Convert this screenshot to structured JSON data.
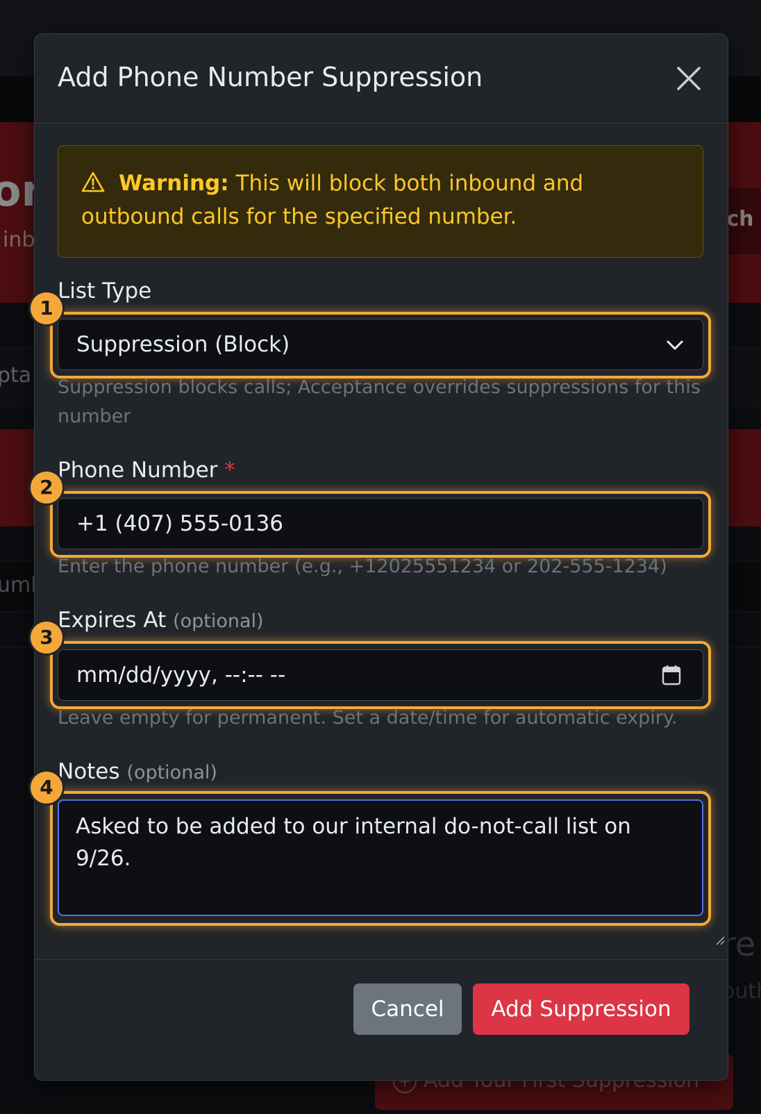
{
  "background": {
    "hero_fragment": "on",
    "hero_sub_fragment": "inb",
    "hero_button_fragment": "ech",
    "row_fragment": "pta",
    "row2_fragment": "umb",
    "empty_title_fragment": "re",
    "empty_sub_fragment": "outh",
    "first_button_label": "Add Your First Suppression"
  },
  "modal": {
    "title": "Add Phone Number Suppression",
    "alert": {
      "strong": "Warning:",
      "text": " This will block both inbound and outbound calls for the specified number."
    },
    "fields": {
      "list_type": {
        "badge": "1",
        "label": "List Type",
        "value": "Suppression (Block)",
        "help": "Suppression blocks calls; Acceptance overrides suppressions for this number"
      },
      "phone": {
        "badge": "2",
        "label": "Phone Number",
        "required_mark": "*",
        "value": "+1 (407) 555-0136",
        "help": "Enter the phone number (e.g., +12025551234 or 202-555-1234)"
      },
      "expires": {
        "badge": "3",
        "label": "Expires At",
        "optional": "(optional)",
        "placeholder": "mm/dd/yyyy, --:-- --",
        "help": "Leave empty for permanent. Set a date/time for automatic expiry."
      },
      "notes": {
        "badge": "4",
        "label": "Notes",
        "optional": "(optional)",
        "value": "Asked to be added to our internal do-not-call list on 9/26."
      }
    },
    "buttons": {
      "cancel": "Cancel",
      "submit": "Add Suppression"
    }
  },
  "colors": {
    "accent_highlight": "#f5a83a",
    "danger": "#dc3545",
    "warning_text": "#ffc827",
    "secondary": "#6c757d"
  },
  "icons": [
    "close-icon",
    "warning-icon",
    "chevron-down-icon",
    "calendar-icon",
    "plus-circle-icon",
    "resize-handle-icon"
  ]
}
